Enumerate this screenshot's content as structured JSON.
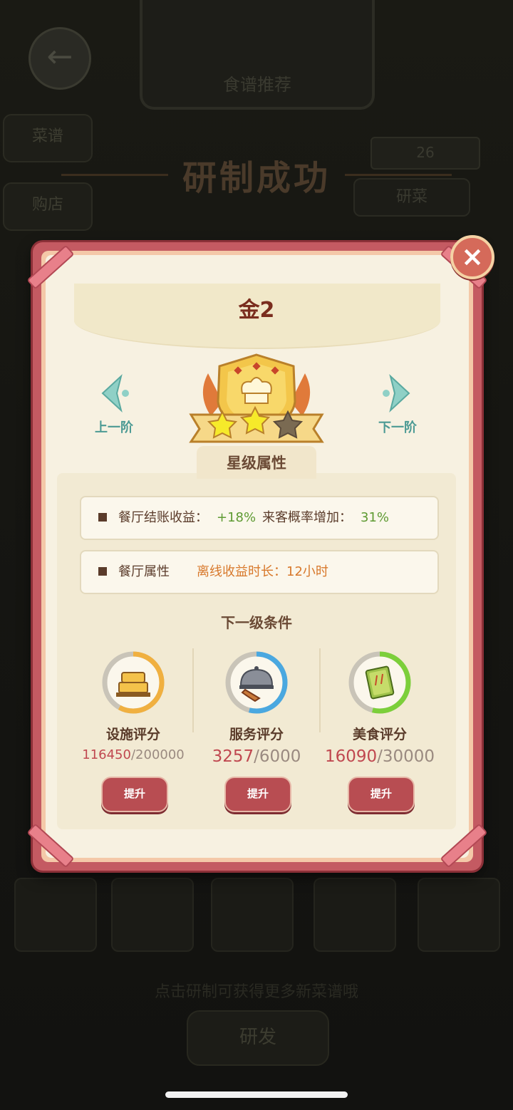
{
  "background": {
    "back_icon": "←",
    "tab_label": "食谱推荐",
    "left_btn_1": "菜谱",
    "left_btn_2": "购店",
    "right_box": "26",
    "right_btn": "研菜",
    "banner_title": "研制成功",
    "hint": "点击研制可获得更多新菜谱哦",
    "bottom_button": "研发"
  },
  "dialog": {
    "title": "金2",
    "close_icon": "×",
    "prev_label": "上一阶",
    "next_label": "下一阶",
    "stars": {
      "filled": 2,
      "total": 3
    },
    "section_title": "星级属性",
    "rows": [
      {
        "label": "餐厅结账收益：",
        "value": "+18%",
        "label2": "来客概率增加：",
        "value2": "31%"
      },
      {
        "label": "餐厅属性",
        "value": "离线收益时长：12小时"
      }
    ],
    "next_level_title": "下一级条件",
    "scores": [
      {
        "name": "设施评分",
        "current": "116450",
        "total": "/200000",
        "progress": 0.58,
        "color": "#f0b040",
        "icon": "facility-icon"
      },
      {
        "name": "服务评分",
        "current": "3257",
        "total": "/6000",
        "progress": 0.54,
        "color": "#4aa8e0",
        "icon": "service-icon"
      },
      {
        "name": "美食评分",
        "current": "16090",
        "total": "/30000",
        "progress": 0.54,
        "color": "#7ccf3a",
        "icon": "food-icon"
      }
    ],
    "upgrade_label": "提升"
  }
}
